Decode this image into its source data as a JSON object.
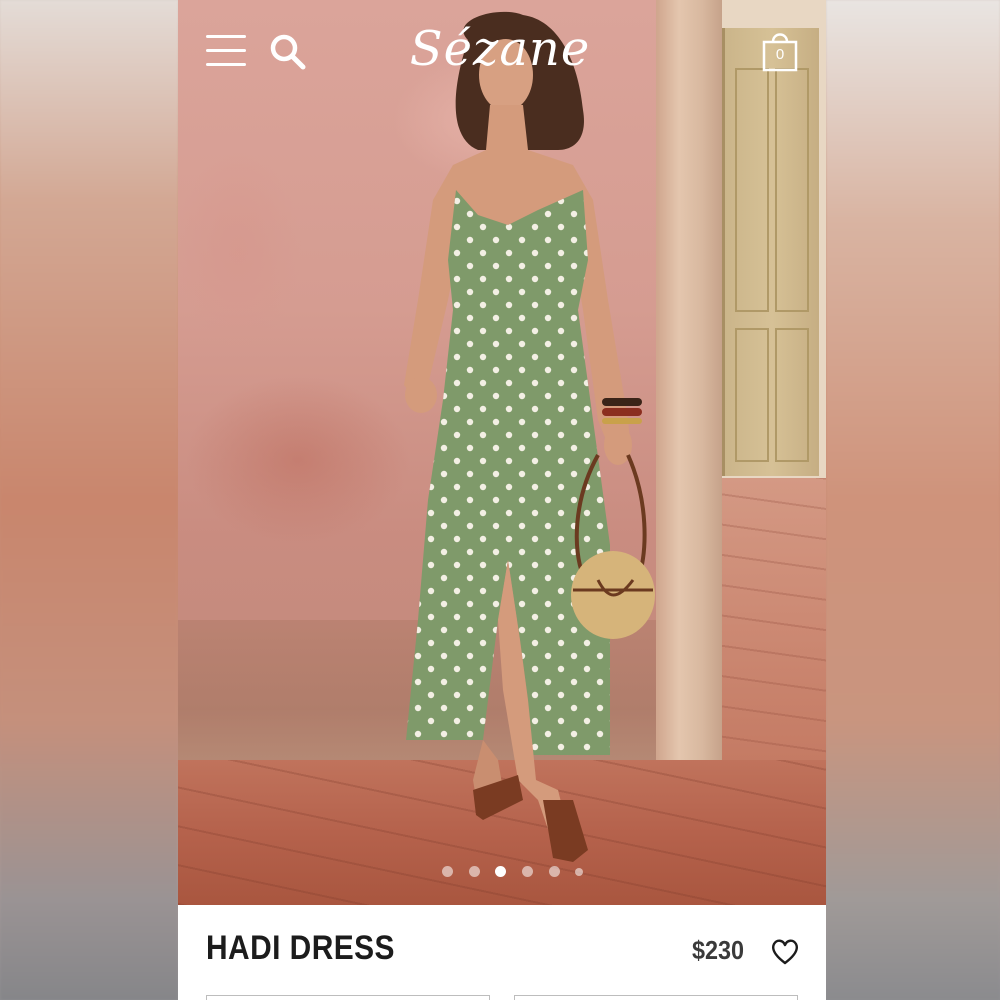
{
  "header": {
    "logo": "Sézane",
    "menu_icon": "hamburger-menu-icon",
    "search_icon": "search-icon",
    "bag_icon": "shopping-bag-icon",
    "bag_count": "0"
  },
  "carousel": {
    "image_description_icon": "product-photo",
    "dots": [
      {
        "active": false
      },
      {
        "active": false
      },
      {
        "active": true
      },
      {
        "active": false
      },
      {
        "active": false
      },
      {
        "active": false
      }
    ]
  },
  "product": {
    "name": "HADI DRESS",
    "price": "$230",
    "wishlist_icon": "heart-icon"
  },
  "colors": {
    "text_dark": "#1c1c1c",
    "background": "#ffffff",
    "dress_green": "#7f9a6a"
  }
}
